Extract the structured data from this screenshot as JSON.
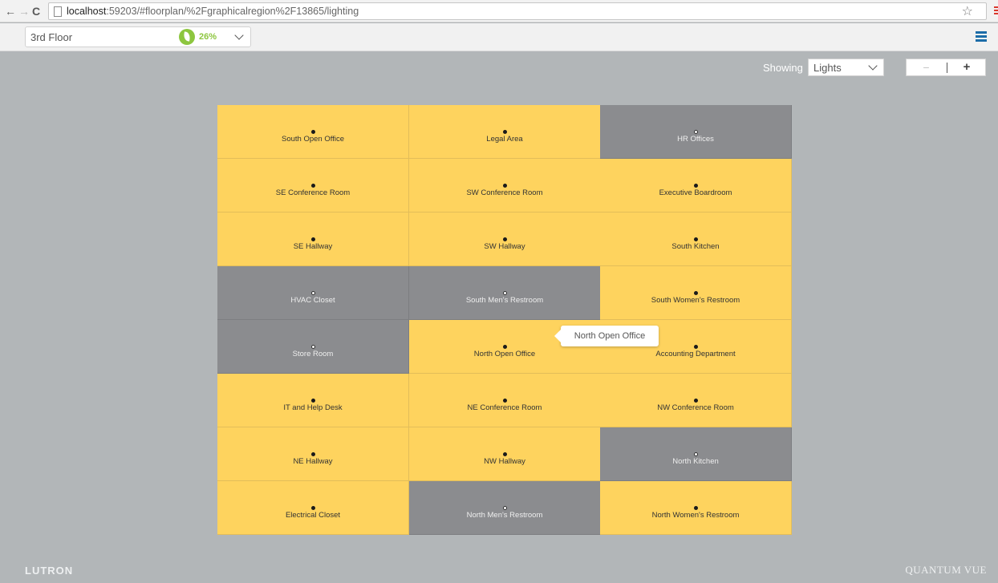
{
  "browser": {
    "url_host": "localhost",
    "url_rest": ":59203/#floorplan/%2Fgraphicalregion%2F13865/lighting",
    "back_icon": "←",
    "forward_icon": "→",
    "reload_icon": "C",
    "star_icon": "☆"
  },
  "header": {
    "floor_name": "3rd Floor",
    "energy_savings": "26%",
    "accent_color": "#8dc63f",
    "menu_color": "#1b6ca8"
  },
  "controls": {
    "showing_label": "Showing",
    "showing_value": "Lights",
    "zoom_out": "−",
    "zoom_in": "+"
  },
  "colors": {
    "light_on": "#fed35e",
    "light_off": "#8b8c8f",
    "background": "#b2b6b8"
  },
  "rooms": [
    {
      "name": "South Open Office",
      "state": "on"
    },
    {
      "name": "Legal Area",
      "state": "on"
    },
    {
      "name": "HR Offices",
      "state": "off"
    },
    {
      "name": "SE Conference Room",
      "state": "on"
    },
    {
      "name": "SW Conference Room",
      "state": "on"
    },
    {
      "name": "Executive Boardroom",
      "state": "on"
    },
    {
      "name": "SE Hallway",
      "state": "on"
    },
    {
      "name": "SW Hallway",
      "state": "on"
    },
    {
      "name": "South Kitchen",
      "state": "on"
    },
    {
      "name": "HVAC Closet",
      "state": "off"
    },
    {
      "name": "South Men's Restroom",
      "state": "off"
    },
    {
      "name": "South Women's Restroom",
      "state": "on"
    },
    {
      "name": "Store Room",
      "state": "off"
    },
    {
      "name": "North Open Office",
      "state": "on"
    },
    {
      "name": "Accounting Department",
      "state": "on"
    },
    {
      "name": "IT and Help Desk",
      "state": "on"
    },
    {
      "name": "NE Conference Room",
      "state": "on"
    },
    {
      "name": "NW Conference Room",
      "state": "on"
    },
    {
      "name": "NE Hallway",
      "state": "on"
    },
    {
      "name": "NW Hallway",
      "state": "on"
    },
    {
      "name": "North Kitchen",
      "state": "off"
    },
    {
      "name": "Electrical Closet",
      "state": "on"
    },
    {
      "name": "North Men's Restroom",
      "state": "off"
    },
    {
      "name": "North Women's Restroom",
      "state": "on"
    }
  ],
  "tooltip": {
    "text": "North Open Office"
  },
  "footer": {
    "brand_left": "LUTRON",
    "brand_right": "QUANTUM VUE"
  }
}
